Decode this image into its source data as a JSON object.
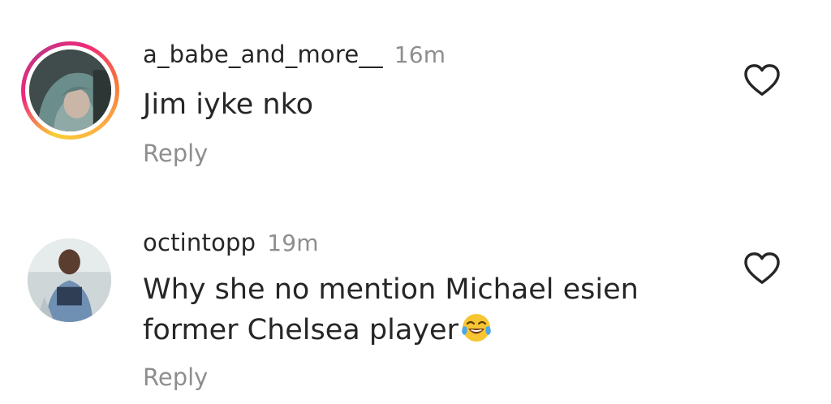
{
  "comments": [
    {
      "username": "a_babe_and_more__",
      "time": "16m",
      "lines": [
        "Jim iyke nko"
      ],
      "reply_label": "Reply",
      "avatar_icon": "user-avatar-story-ring",
      "like_icon": "heart-outline-icon"
    },
    {
      "username": "octintopp",
      "time": "19m",
      "lines": [
        "Why she no mention Michael esien",
        "former Chelsea player"
      ],
      "emoji": "face-with-tears-of-joy",
      "reply_label": "Reply",
      "avatar_icon": "user-avatar",
      "like_icon": "heart-outline-icon"
    }
  ],
  "colors": {
    "text": "#262626",
    "muted": "#8e8e8e",
    "story_ring": [
      "#f9ce34",
      "#ee2a7b",
      "#c13584"
    ]
  }
}
